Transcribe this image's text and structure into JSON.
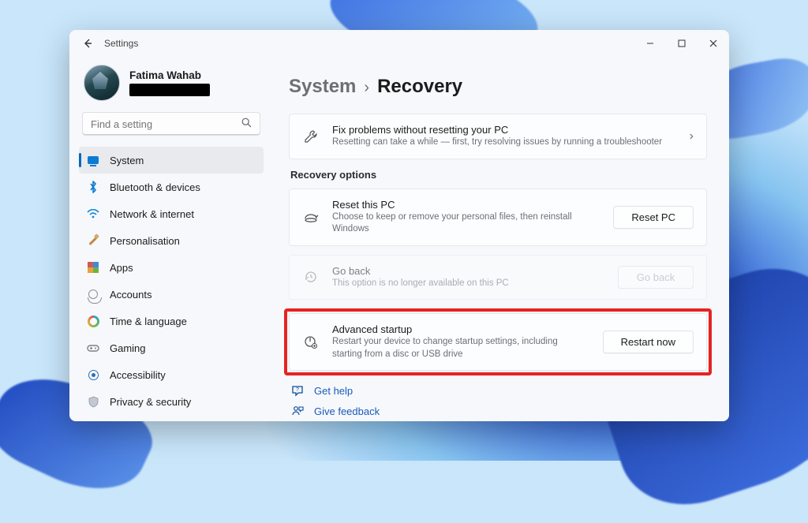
{
  "window_title": "Settings",
  "profile": {
    "name": "Fatima Wahab"
  },
  "search": {
    "placeholder": "Find a setting"
  },
  "sidebar": {
    "items": [
      {
        "label": "System"
      },
      {
        "label": "Bluetooth & devices"
      },
      {
        "label": "Network & internet"
      },
      {
        "label": "Personalisation"
      },
      {
        "label": "Apps"
      },
      {
        "label": "Accounts"
      },
      {
        "label": "Time & language"
      },
      {
        "label": "Gaming"
      },
      {
        "label": "Accessibility"
      },
      {
        "label": "Privacy & security"
      }
    ]
  },
  "breadcrumb": {
    "parent": "System",
    "current": "Recovery"
  },
  "fix_card": {
    "title": "Fix problems without resetting your PC",
    "subtitle": "Resetting can take a while — first, try resolving issues by running a troubleshooter"
  },
  "section_label": "Recovery options",
  "reset_card": {
    "title": "Reset this PC",
    "subtitle": "Choose to keep or remove your personal files, then reinstall Windows",
    "button": "Reset PC"
  },
  "goback_card": {
    "title": "Go back",
    "subtitle": "This option is no longer available on this PC",
    "button": "Go back"
  },
  "adv_card": {
    "title": "Advanced startup",
    "subtitle": "Restart your device to change startup settings, including starting from a disc or USB drive",
    "button": "Restart now"
  },
  "links": {
    "help": "Get help",
    "feedback": "Give feedback"
  }
}
